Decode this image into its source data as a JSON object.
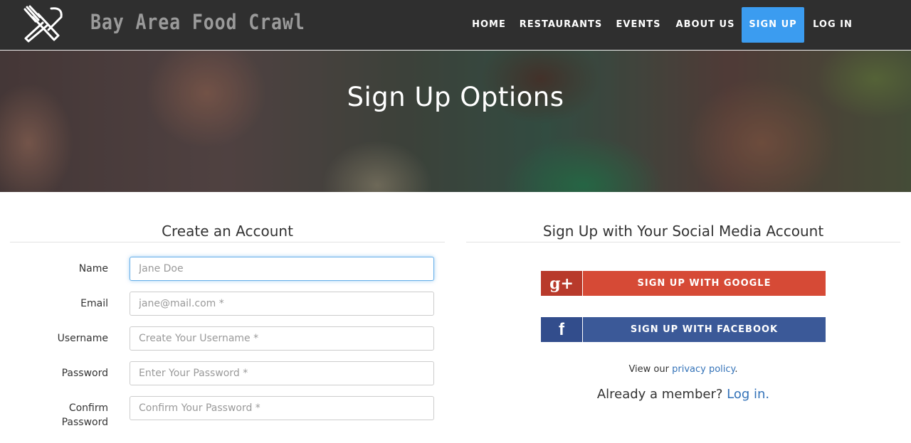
{
  "brand": {
    "name": "Bay Area Food Crawl",
    "logo_icon": "fork-knife-crossed-icon"
  },
  "nav": {
    "items": [
      {
        "label": "HOME"
      },
      {
        "label": "RESTAURANTS"
      },
      {
        "label": "EVENTS"
      },
      {
        "label": "ABOUT US"
      },
      {
        "label": "SIGN UP",
        "active": true
      },
      {
        "label": "LOG IN"
      }
    ]
  },
  "hero": {
    "title": "Sign Up Options"
  },
  "create_account": {
    "title": "Create an Account",
    "fields": [
      {
        "label": "Name",
        "placeholder": "Jane Doe",
        "value": ""
      },
      {
        "label": "Email",
        "placeholder": "jane@mail.com *",
        "value": ""
      },
      {
        "label": "Username",
        "placeholder": "Create Your Username *",
        "value": ""
      },
      {
        "label": "Password",
        "placeholder": "Enter Your Password *",
        "value": ""
      },
      {
        "label": "Confirm Password",
        "placeholder": "Confirm Your Password *",
        "value": ""
      }
    ]
  },
  "social": {
    "title": "Sign Up with Your Social Media Account",
    "google": {
      "label": "SIGN UP WITH GOOGLE",
      "icon": "g+",
      "icon_name": "google-plus-icon"
    },
    "facebook": {
      "label": "SIGN UP WITH FACEBOOK",
      "icon": "f",
      "icon_name": "facebook-icon"
    },
    "privacy_prefix": "View our",
    "privacy_link": "privacy policy",
    "privacy_suffix": ".",
    "member_prefix": "Already a member?",
    "member_link": "Log in."
  },
  "colors": {
    "navbar": "#2f2f2f",
    "nav_active": "#3b9cf0",
    "google": "#d64a36",
    "facebook": "#3b5998",
    "link": "#3372b8"
  }
}
